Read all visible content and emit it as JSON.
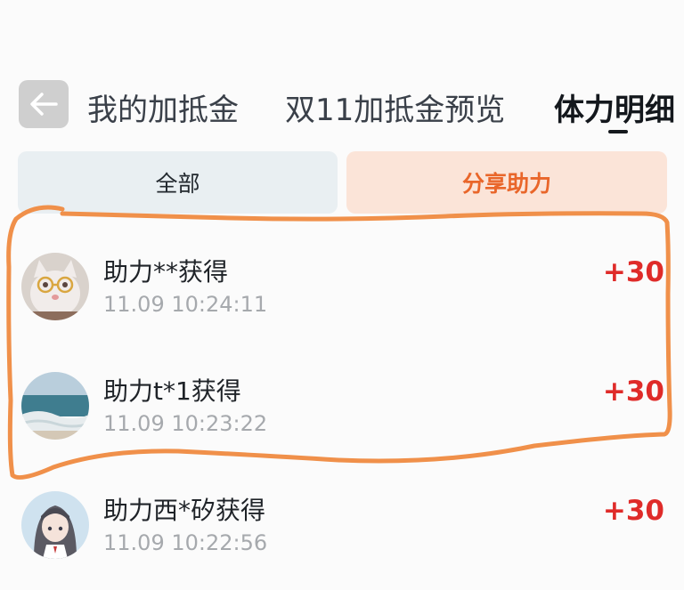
{
  "header": {
    "tabs": [
      {
        "label": "我的加抵金"
      },
      {
        "label": "双11加抵金预览"
      },
      {
        "label": "体力明细"
      }
    ]
  },
  "filters": [
    {
      "label": "全部"
    },
    {
      "label": "分享助力"
    }
  ],
  "records": [
    {
      "title": "助力**获得",
      "time": "11.09 10:24:11",
      "points": "+30",
      "avatar": "cat-avatar"
    },
    {
      "title": "助力t*1获得",
      "time": "11.09 10:23:22",
      "points": "+30",
      "avatar": "beach-avatar"
    },
    {
      "title": "助力西*矽获得",
      "time": "11.09 10:22:56",
      "points": "+30",
      "avatar": "anime-girl-avatar"
    }
  ],
  "colors": {
    "points": "#df2b29",
    "share_tab_text": "#e9662a",
    "share_tab_bg": "#fbe4d8",
    "all_tab_bg": "#e9eff2",
    "annotation": "#f0904a"
  }
}
